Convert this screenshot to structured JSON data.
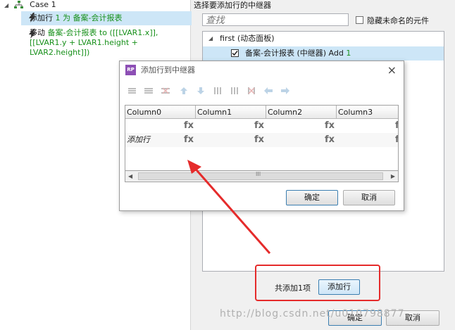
{
  "left": {
    "case_label": "Case 1",
    "actions": [
      {
        "verb": "添加行",
        "detail_green": "1 为 备案-会计报表"
      },
      {
        "verb": "移动",
        "detail_green": "备案-会计报表",
        "detail": "to ([[LVAR1.x]],",
        "line2": "[[LVAR1.y + LVAR1.height +",
        "line3": "LVAR2.height]])"
      }
    ]
  },
  "right": {
    "title": "选择要添加行的中继器",
    "search_placeholder": "查找",
    "hide_unnamed_label": "隐藏未命名的元件",
    "tree": {
      "parent": "first (动态面板)",
      "child_name": "备案-会计报表 (中继器) Add",
      "child_count": "1"
    },
    "summary": "共添加1项",
    "add_rows_button": "添加行",
    "ok_button": "确定",
    "cancel_button": "取消"
  },
  "dialog": {
    "title": "添加行到中继器",
    "close": "×",
    "columns": [
      "Column0",
      "Column1",
      "Column2",
      "Column3"
    ],
    "fx": "fx",
    "row2_first": "添加行",
    "scroll_grip": "III",
    "ok_button": "确定",
    "cancel_button": "取消"
  },
  "watermark": "http://blog.csdn.net/u010798877",
  "colors": {
    "selection": "#cde6f7",
    "green_text": "#17901a",
    "annotation_red": "#e52b2b"
  }
}
